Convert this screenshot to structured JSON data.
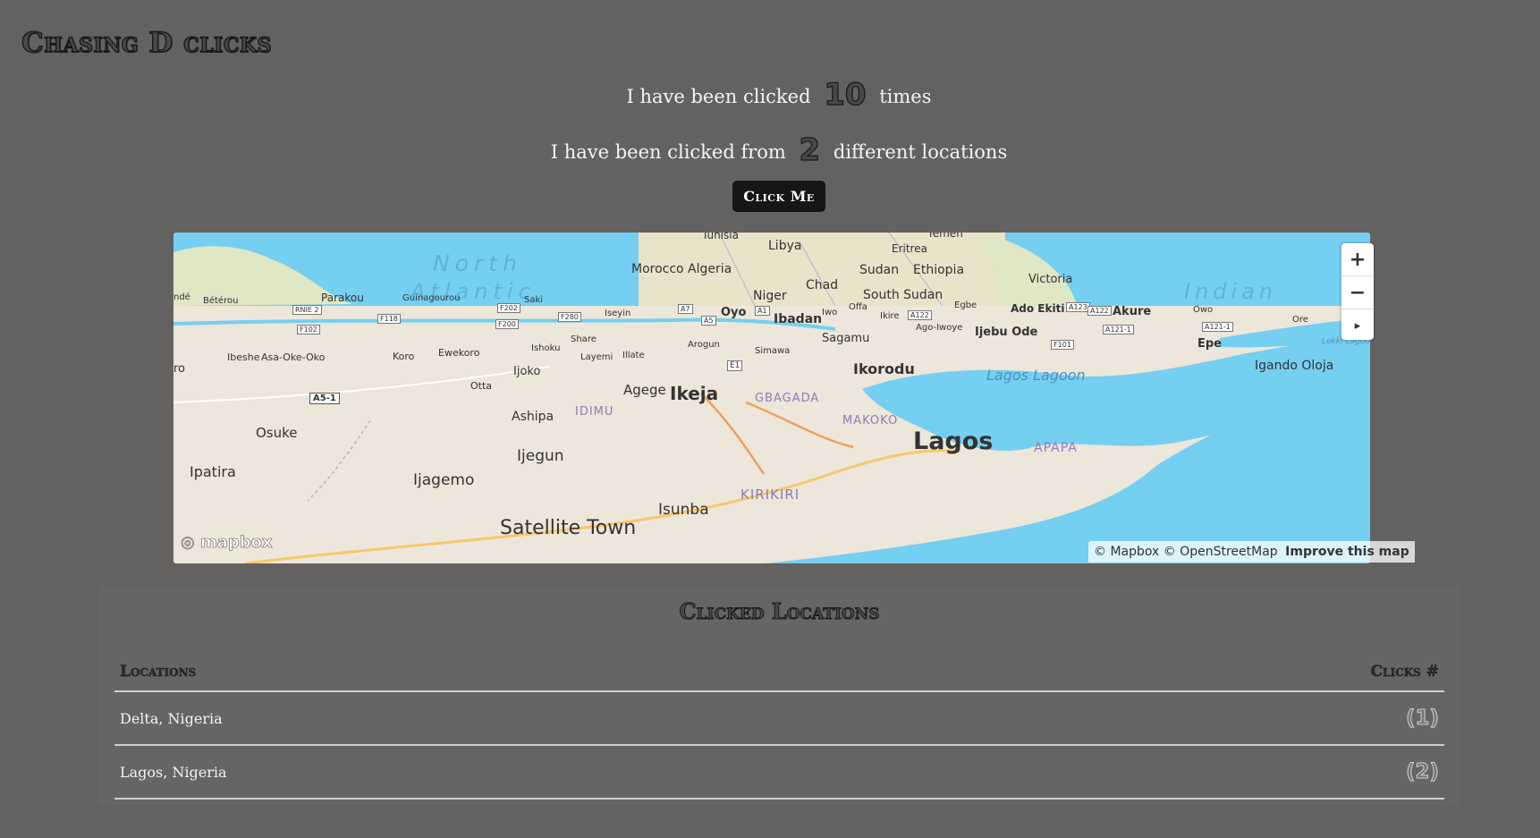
{
  "header": {
    "title": "Chasing D clicks"
  },
  "stats": {
    "clicks_prefix": "I have been clicked",
    "clicks_value": "10",
    "clicks_suffix": "times",
    "locations_prefix": "I have been clicked from",
    "locations_value": "2",
    "locations_suffix": "different locations"
  },
  "button": {
    "label": "Click Me"
  },
  "map": {
    "water_color": "#75cff0",
    "land_color": "#ede6da",
    "labels": [
      {
        "text": "Libya",
        "size": "large"
      },
      {
        "text": "Tunisia",
        "size": "small"
      },
      {
        "text": "Eritrea",
        "size": "small"
      },
      {
        "text": "Yemen",
        "size": "small"
      },
      {
        "text": "North",
        "size": "ocean"
      },
      {
        "text": "Atlantic",
        "size": "ocean"
      },
      {
        "text": "Morocco",
        "size": "large"
      },
      {
        "text": "Algeria",
        "size": "large"
      },
      {
        "text": "Sudan",
        "size": "large"
      },
      {
        "text": "Ethiopia",
        "size": "large"
      },
      {
        "text": "Victoria",
        "size": "medium"
      },
      {
        "text": "Indian",
        "size": "ocean"
      },
      {
        "text": "Chad",
        "size": "large"
      },
      {
        "text": "Niger",
        "size": "large"
      },
      {
        "text": "South Sudan",
        "size": "large"
      },
      {
        "text": "Parakou",
        "size": "medium"
      },
      {
        "text": "Bétérou",
        "size": "small"
      },
      {
        "text": "Guinagourou",
        "size": "small"
      },
      {
        "text": "Saki",
        "size": "small"
      },
      {
        "text": "Iseyin",
        "size": "small"
      },
      {
        "text": "Oyo",
        "size": "medium"
      },
      {
        "text": "Ibadan",
        "size": "large"
      },
      {
        "text": "Iwo",
        "size": "small"
      },
      {
        "text": "Offa",
        "size": "small"
      },
      {
        "text": "Ikire",
        "size": "small"
      },
      {
        "text": "Egbe",
        "size": "small"
      },
      {
        "text": "Ado Ekiti",
        "size": "medium"
      },
      {
        "text": "Akure",
        "size": "medium"
      },
      {
        "text": "Owo",
        "size": "small"
      },
      {
        "text": "Ore",
        "size": "small"
      },
      {
        "text": "Ago-Iwoye",
        "size": "small"
      },
      {
        "text": "Ijebu Ode",
        "size": "medium"
      },
      {
        "text": "Epe",
        "size": "medium"
      },
      {
        "text": "Lekki Lagoon",
        "size": "water"
      },
      {
        "text": "Sagamu",
        "size": "medium"
      },
      {
        "text": "Share",
        "size": "small"
      },
      {
        "text": "Ishoku",
        "size": "small"
      },
      {
        "text": "Layemi",
        "size": "small"
      },
      {
        "text": "Illate",
        "size": "small"
      },
      {
        "text": "Arogun",
        "size": "small"
      },
      {
        "text": "Simawa",
        "size": "small"
      },
      {
        "text": "Ibeshe",
        "size": "small"
      },
      {
        "text": "Asa-Oke-Oko",
        "size": "small"
      },
      {
        "text": "Koro",
        "size": "small"
      },
      {
        "text": "Ewekoro",
        "size": "small"
      },
      {
        "text": "Ijoko",
        "size": "medium"
      },
      {
        "text": "Otta",
        "size": "small"
      },
      {
        "text": "Ikorodu",
        "size": "city"
      },
      {
        "text": "Lagos Lagoon",
        "size": "water"
      },
      {
        "text": "Igando Oloja",
        "size": "medium"
      },
      {
        "text": "Agege",
        "size": "large"
      },
      {
        "text": "Ikeja",
        "size": "city"
      },
      {
        "text": "GBAGADA",
        "size": "district"
      },
      {
        "text": "Ashipa",
        "size": "medium"
      },
      {
        "text": "IDIMU",
        "size": "district"
      },
      {
        "text": "Osuke",
        "size": "large"
      },
      {
        "text": "MAKOKO",
        "size": "district"
      },
      {
        "text": "Lagos",
        "size": "capital"
      },
      {
        "text": "APAPA",
        "size": "district"
      },
      {
        "text": "Ipatira",
        "size": "large"
      },
      {
        "text": "Ijegun",
        "size": "large"
      },
      {
        "text": "Ijagemo",
        "size": "large"
      },
      {
        "text": "KIRIKIRI",
        "size": "district"
      },
      {
        "text": "Isunba",
        "size": "large"
      },
      {
        "text": "Satellite Town",
        "size": "city"
      },
      {
        "text": "ro",
        "size": "medium"
      },
      {
        "text": "ndé",
        "size": "small"
      }
    ],
    "road_shields": [
      "RNIE 2",
      "F102",
      "F118",
      "F202",
      "F200",
      "F280",
      "A7",
      "A5",
      "A1",
      "A122",
      "A123",
      "A122",
      "A121-1",
      "A121-1",
      "F101",
      "E1",
      "A5-1"
    ]
  },
  "map_controls": {
    "zoom_in_icon": "+",
    "zoom_out_icon": "−",
    "compass_icon": "▸"
  },
  "attribution": {
    "mapbox": "© Mapbox",
    "osm": "© OpenStreetMap",
    "improve": "Improve this map",
    "logo": "mapbox"
  },
  "clicked_locations": {
    "title": "Clicked Locations",
    "columns": [
      "Locations",
      "Clicks #"
    ],
    "rows": [
      {
        "location": "Delta, Nigeria",
        "clicks": "(1)"
      },
      {
        "location": "Lagos, Nigeria",
        "clicks": "(2)"
      }
    ]
  }
}
